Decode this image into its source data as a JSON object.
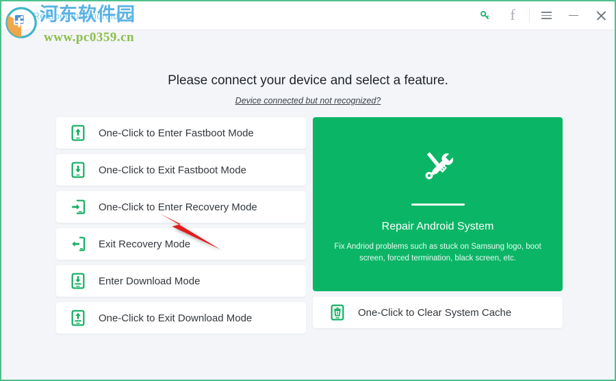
{
  "window": {
    "border_color": "#4ec08c",
    "background": "#f3f5f9"
  },
  "titlebar": {
    "app_title": "ReiBoot for Android",
    "app_title_color": "#7fd0ef",
    "icons": {
      "key": "key-icon",
      "facebook": "f",
      "menu": "hamburger-menu-icon",
      "minimize": "minimize-icon",
      "close": "close-icon"
    }
  },
  "watermark": {
    "chinese": "河东软件园",
    "url": "www.pc0359.cn",
    "chinese_color": "#5bb3e4",
    "url_color": "#8dbe4a"
  },
  "header": {
    "headline": "Please connect your device and select a feature.",
    "link": "Device connected but not recognized?"
  },
  "left_options": [
    {
      "label": "One-Click to Enter Fastboot Mode",
      "icon": "phone-arrow-up-icon"
    },
    {
      "label": "One-Click to Exit Fastboot Mode",
      "icon": "phone-arrow-down-icon"
    },
    {
      "label": "One-Click to Enter Recovery Mode",
      "icon": "phone-arrow-in-icon"
    },
    {
      "label": "Exit Recovery Mode",
      "icon": "phone-arrow-out-icon"
    },
    {
      "label": "Enter Download Mode",
      "icon": "phone-download-icon"
    },
    {
      "label": "One-Click to Exit Download Mode",
      "icon": "phone-upload-icon"
    }
  ],
  "repair_card": {
    "title": "Repair Android System",
    "description": "Fix Andriod problems such as stuck on Samsung logo, boot screen, forced termination, black screen, etc.",
    "icon": "screwdriver-wrench-icon",
    "background": "#0bb566"
  },
  "right_options": [
    {
      "label": "One-Click to Clear System Cache",
      "icon": "phone-trash-icon"
    }
  ],
  "annotation": {
    "pointer": "red-arrow-cursor",
    "color": "#e01b1b"
  },
  "accent": {
    "green": "#0bb566",
    "icon_green": "#0dae5e"
  }
}
